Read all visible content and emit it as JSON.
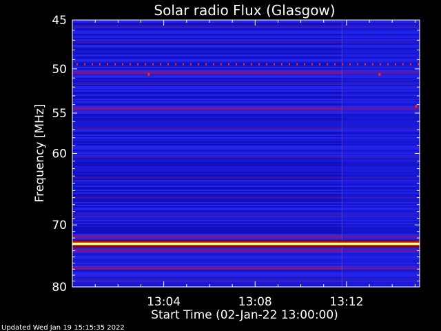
{
  "chart_data": {
    "type": "heatmap",
    "title": "Solar radio Flux (Glasgow)",
    "ylabel": "Frequency [MHz]",
    "xlabel": "Start Time (02-Jan-22 13:00:00)",
    "footer": "Updated Wed Jan 19 15:15:35 2022",
    "y_scale": "log",
    "ylim": [
      80,
      45
    ],
    "yticks": [
      45,
      50,
      55,
      60,
      70,
      80
    ],
    "xlim_minutes": [
      0,
      15.2
    ],
    "xticks": [
      {
        "label": "13:04",
        "minute": 4
      },
      {
        "label": "13:08",
        "minute": 8
      },
      {
        "label": "13:12",
        "minute": 12
      }
    ],
    "bands": [
      {
        "f": 45.6,
        "level": "weak"
      },
      {
        "f": 47.2,
        "level": "weak"
      },
      {
        "f": 50.4,
        "level": "medium"
      },
      {
        "f": 51.6,
        "level": "weak"
      },
      {
        "f": 54.5,
        "level": "medium"
      },
      {
        "f": 56.8,
        "level": "weak"
      },
      {
        "f": 60.5,
        "level": "weak"
      },
      {
        "f": 63.2,
        "level": "weak"
      },
      {
        "f": 66.0,
        "level": "weak"
      },
      {
        "f": 68.5,
        "level": "weak"
      },
      {
        "f": 71.8,
        "level": "medium"
      },
      {
        "f": 74.0,
        "level": "medium"
      },
      {
        "f": 76.8,
        "level": "medium"
      },
      {
        "f": 78.8,
        "level": "weak"
      }
    ],
    "hot_line_f": 72.9,
    "dotted_line_f": 49.5,
    "data_gap_minute": 11.8,
    "colors": {
      "low": "#1a1adc",
      "medium": "#7a1a8c",
      "high": "#e23a00",
      "peak": "#ffff9a",
      "dot": "#ff2a00"
    }
  }
}
